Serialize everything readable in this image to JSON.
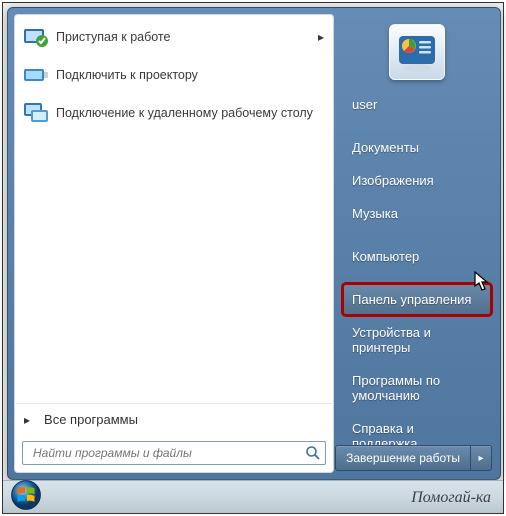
{
  "left": {
    "items": [
      {
        "label": "Приступая к работе",
        "has_submenu": true
      },
      {
        "label": "Подключить к проектору",
        "has_submenu": false
      },
      {
        "label": "Подключение к удаленному рабочему столу",
        "has_submenu": false
      }
    ],
    "all_programs": "Все программы",
    "search_placeholder": "Найти программы и файлы"
  },
  "right": {
    "user": "user",
    "items_a": [
      "Документы",
      "Изображения",
      "Музыка"
    ],
    "items_b": [
      "Компьютер"
    ],
    "items_c": [
      "Панель управления",
      "Устройства и принтеры",
      "Программы по умолчанию",
      "Справка и поддержка"
    ],
    "selected": "Панель управления",
    "shutdown": "Завершение работы"
  },
  "watermark": "Помогай-ка"
}
